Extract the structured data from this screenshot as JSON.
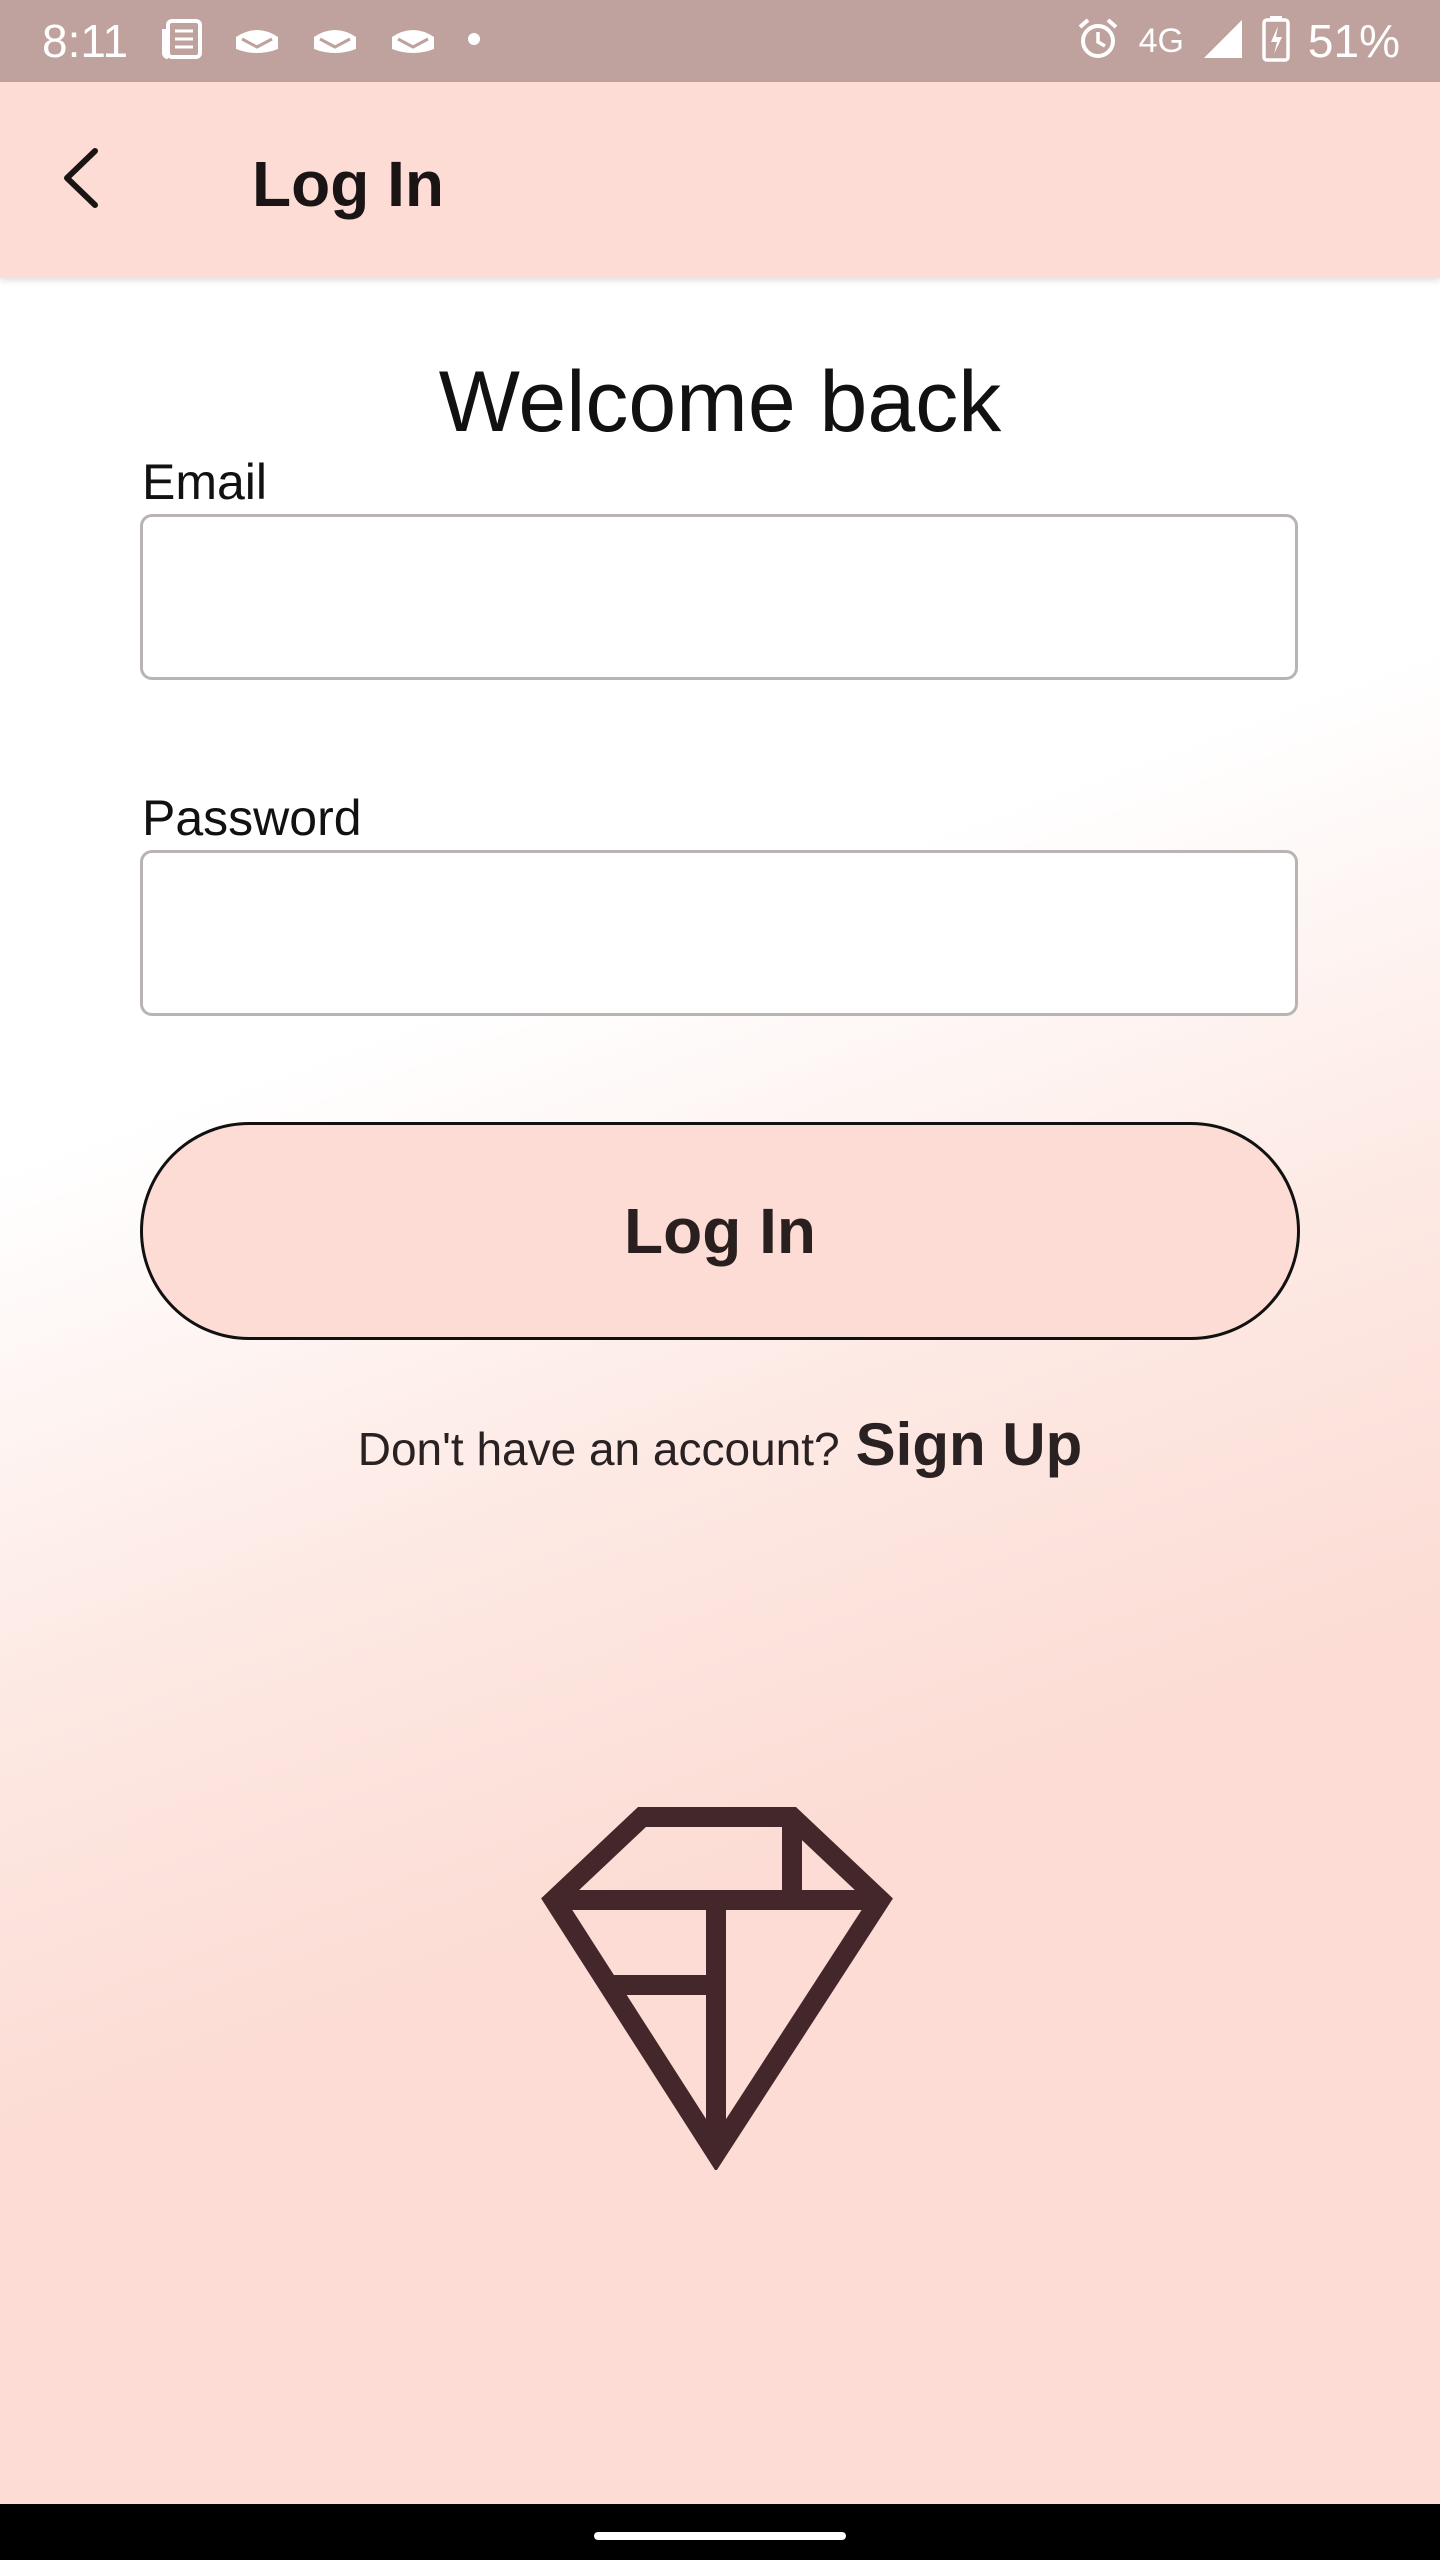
{
  "status_bar": {
    "time": "8:11",
    "network": "4G",
    "battery": "51%",
    "icons_left": [
      "news-icon",
      "mail-icon",
      "mail-icon",
      "mail-icon",
      "dot-icon"
    ],
    "icons_right": [
      "alarm-icon",
      "signal-icon",
      "battery-charging-icon"
    ]
  },
  "app_bar": {
    "title": "Log In",
    "back_icon": "back-arrow-icon"
  },
  "content": {
    "welcome": "Welcome back",
    "email": {
      "label": "Email",
      "value": "",
      "placeholder": ""
    },
    "password": {
      "label": "Password",
      "value": "",
      "placeholder": ""
    },
    "login_button": "Log In",
    "signup_prompt": "Don't have an account?",
    "signup_link": "Sign Up",
    "logo_icon": "diamond-logo-icon"
  },
  "colors": {
    "status_bar": "#bfa29e",
    "app_bar": "#fcdcd4",
    "button_fill": "#fcdcd4",
    "logo": "#43272a",
    "text": "#111111"
  }
}
